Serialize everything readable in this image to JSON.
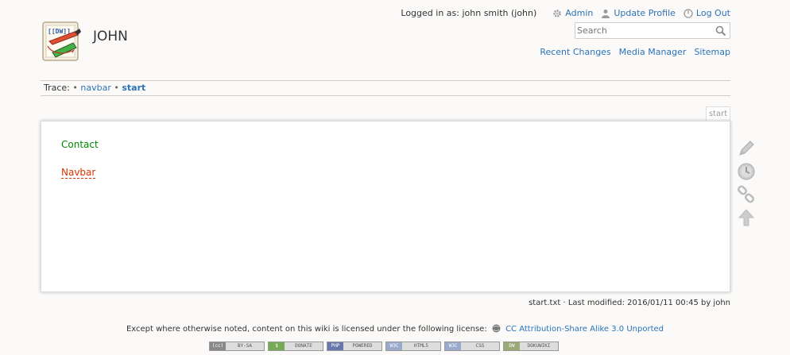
{
  "header": {
    "site_title": "JOHN",
    "logo_text": "[[DW]]",
    "logged_in_text": "Logged in as: john smith (john)",
    "user_tools": [
      {
        "label": "Admin",
        "icon": "gear-icon"
      },
      {
        "label": "Update Profile",
        "icon": "user-icon"
      },
      {
        "label": "Log Out",
        "icon": "power-icon"
      }
    ],
    "search": {
      "placeholder": "Search"
    },
    "site_tools": [
      "Recent Changes",
      "Media Manager",
      "Sitemap"
    ]
  },
  "breadcrumbs": {
    "prefix": "Trace:",
    "sep": "•",
    "items": [
      "navbar",
      "start"
    ]
  },
  "page": {
    "tab_label": "start",
    "links": {
      "contact": "Contact",
      "navbar": "Navbar"
    },
    "page_tools": [
      "edit-icon",
      "revisions-icon",
      "backlinks-icon",
      "back-to-top-icon"
    ]
  },
  "docinfo": "start.txt · Last modified: 2016/01/11 00:45 by john",
  "license": {
    "text": "Except where otherwise noted, content on this wiki is licensed under the following license:",
    "link": "CC Attribution-Share Alike 3.0 Unported"
  },
  "badges": [
    {
      "tag": "(cc)",
      "label": "BY-SA",
      "color": "#888888"
    },
    {
      "tag": "$",
      "label": "DONATE",
      "color": "#77aa55"
    },
    {
      "tag": "PHP",
      "label": "POWERED",
      "color": "#6677aa"
    },
    {
      "tag": "W3C",
      "label": "HTML5",
      "color": "#99aacc"
    },
    {
      "tag": "W3C",
      "label": "CSS",
      "color": "#99aacc"
    },
    {
      "tag": "DW",
      "label": "DOKUWIKI",
      "color": "#99aa77"
    }
  ]
}
